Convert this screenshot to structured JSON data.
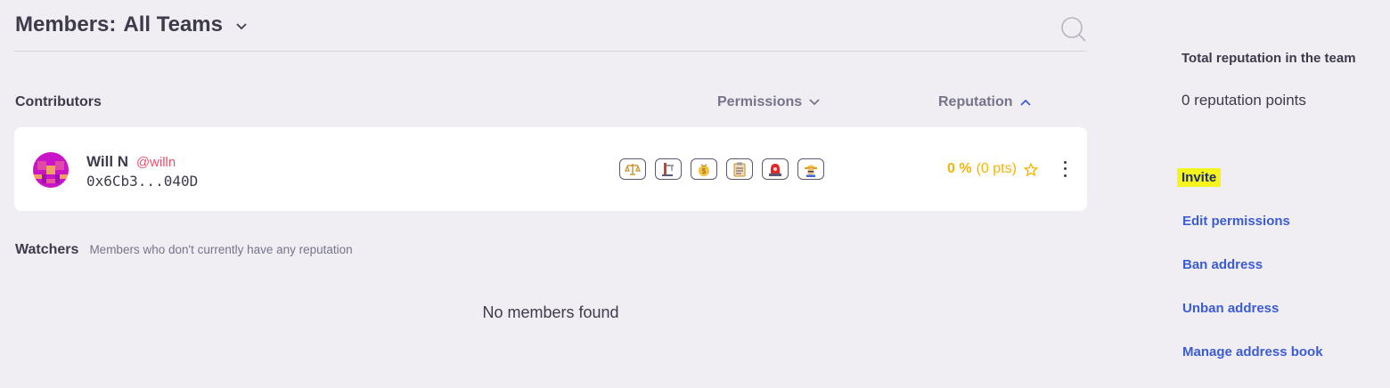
{
  "header": {
    "title_prefix": "Members:",
    "team_selector": "All Teams"
  },
  "columns": {
    "contributors": "Contributors",
    "permissions": "Permissions",
    "reputation": "Reputation"
  },
  "contributors": [
    {
      "name": "Will N",
      "handle": "@willn",
      "address": "0x6Cb3...040D",
      "permissions": [
        "arbitration-icon",
        "architecture-icon",
        "funding-icon",
        "administration-icon",
        "recovery-icon",
        "root-icon"
      ],
      "reputation_percent": "0 %",
      "reputation_points": "(0 pts)"
    }
  ],
  "watchers": {
    "title": "Watchers",
    "description": "Members who don't currently have any reputation",
    "empty_message": "No members found"
  },
  "sidebar": {
    "total_title": "Total reputation in the team",
    "total_value": "0 reputation points",
    "links": {
      "invite": "Invite",
      "edit_permissions": "Edit permissions",
      "ban_address": "Ban address",
      "unban_address": "Unban address",
      "manage_address_book": "Manage address book"
    }
  },
  "colors": {
    "accent_link": "#3b5cd6",
    "handle": "#f0506e",
    "reputation": "#f5b400",
    "highlight": "#f5f51d"
  }
}
